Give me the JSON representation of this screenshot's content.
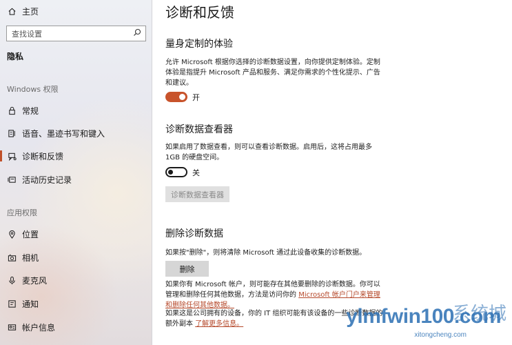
{
  "sidebar": {
    "home_label": "主页",
    "search_placeholder": "查找设置",
    "section_title": "隐私",
    "windows_perms_header": "Windows 权限",
    "windows_items": [
      {
        "label": "常规",
        "icon": "lock-icon"
      },
      {
        "label": "语音、墨迹书写和键入",
        "icon": "speech-inking-icon"
      },
      {
        "label": "诊断和反馈",
        "icon": "diagnostics-feedback-icon",
        "active": true
      },
      {
        "label": "活动历史记录",
        "icon": "activity-history-icon"
      }
    ],
    "app_perms_header": "应用权限",
    "app_items": [
      {
        "label": "位置",
        "icon": "location-icon"
      },
      {
        "label": "相机",
        "icon": "camera-icon"
      },
      {
        "label": "麦克风",
        "icon": "microphone-icon"
      },
      {
        "label": "通知",
        "icon": "notification-icon"
      },
      {
        "label": "帐户信息",
        "icon": "account-info-icon"
      }
    ],
    "accent_color": "#c0502a"
  },
  "main": {
    "title": "诊断和反馈",
    "tailored": {
      "heading": "量身定制的体验",
      "description": "允许 Microsoft 根据你选择的诊断数据设置，向你提供定制体验。定制体验是指提升 Microsoft 产品和服务、满足你需求的个性化提示、广告和建议。",
      "toggle_state": "开",
      "toggle_on": true
    },
    "viewer": {
      "heading": "诊断数据查看器",
      "description": "如果启用了数据查看，则可以查看诊断数据。启用后，这将占用最多 1GB 的硬盘空间。",
      "toggle_state": "关",
      "toggle_on": false,
      "button_label": "诊断数据查看器"
    },
    "delete": {
      "heading": "删除诊断数据",
      "description": "如果按\"删除\"，则将清除 Microsoft 通过此设备收集的诊断数据。",
      "button_label": "删除",
      "note1_text": "如果你有 Microsoft 帐户，则可能存在其他要删除的诊断数据。你可以管理和删除任何其他数据，方法是访问你的 ",
      "note1_link": "Microsoft 帐户门户来管理和删除任何其他数据。",
      "note2_text": "如果这是公司拥有的设备，你的 IT 组织可能有该设备的一些诊断数据的额外副本 ",
      "note2_link": "了解更多信息。"
    },
    "toggle_on_color": "#c8532b",
    "link_color": "#b5482a"
  },
  "watermark": {
    "main": "ylmfwin100.com",
    "cn": "系统城",
    "sub": "xitongcheng.com"
  }
}
